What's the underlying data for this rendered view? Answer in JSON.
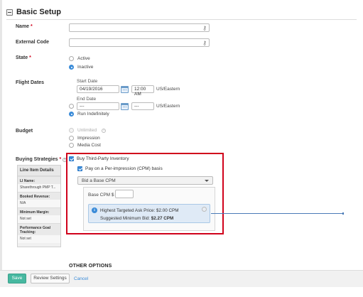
{
  "section": {
    "title": "Basic Setup"
  },
  "fields": {
    "name": {
      "label": "Name",
      "required_mark": "*",
      "value": ""
    },
    "external_code": {
      "label": "External Code",
      "value": ""
    },
    "state": {
      "label": "State",
      "required_mark": "*",
      "options": [
        "Active",
        "Inactive"
      ],
      "selected": "Inactive"
    },
    "flight_dates": {
      "label": "Flight Dates",
      "start_label": "Start Date",
      "start_date": "04/19/2016",
      "start_time": "12:00 AM",
      "start_tz": "US/Eastern",
      "end_label": "End Date",
      "end_date": "---",
      "end_time": "---",
      "end_tz": "US/Eastern",
      "run_indefinitely": "Run Indefinitely"
    },
    "budget": {
      "label": "Budget",
      "options": [
        "Unlimited",
        "Impression",
        "Media Cost"
      ]
    },
    "buying_strategies": {
      "label": "Buying Strategies",
      "required_mark": "*",
      "buy_third_party": "Buy Third-Party Inventory",
      "pay_cpm": "Pay on a Per-impression (CPM) basis",
      "bid_dropdown": "Bid a Base CPM",
      "base_cpm_label": "Base CPM $",
      "base_cpm_value": "",
      "info_line1": "Highest Targeted Ask Price: $2.00 CPM",
      "info_line2_prefix": "Suggested Minimum Bid:",
      "info_line2_value": "$2.27 CPM"
    }
  },
  "line_item_details": {
    "title": "Line Item Details",
    "rows": [
      {
        "key": "LI Name:",
        "value": "Sharethrough PMP T..."
      },
      {
        "key": "Booked Revenue:",
        "value": "N/A"
      },
      {
        "key": "Minimum Margin:",
        "value": "Not set"
      },
      {
        "key": "Performance Goal Tracking:",
        "value": "Not set"
      }
    ]
  },
  "other_options": "OTHER OPTIONS",
  "footer": {
    "save": "Save",
    "review": "Review Settings",
    "cancel": "Cancel"
  },
  "colors": {
    "accent_blue": "#3a8bd8",
    "save_green": "#47b8a0",
    "highlight_red": "#d0021b",
    "required_red": "#d0021b"
  },
  "icons": [
    "collapse-icon",
    "key-icon",
    "calendar-icon",
    "info-icon",
    "help-icon"
  ]
}
